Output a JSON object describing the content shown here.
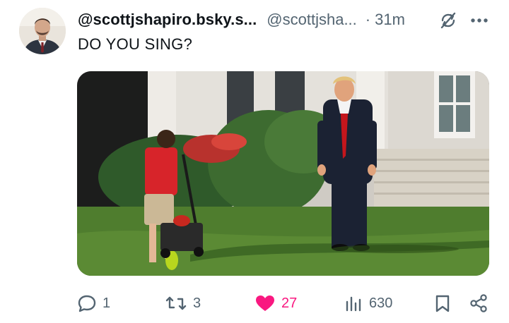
{
  "post": {
    "display_name": "@scottjshapiro.bsky.s...",
    "handle": "@scottjsha...",
    "separator": "·",
    "time": "31m",
    "text": "DO YOU SING?",
    "header_icons": [
      "no-sync-icon",
      "more-icon"
    ]
  },
  "actions": {
    "reply": {
      "icon": "reply-icon",
      "count": "1"
    },
    "repost": {
      "icon": "repost-icon",
      "count": "3"
    },
    "like": {
      "icon": "heart-icon",
      "count": "27",
      "active": true
    },
    "views": {
      "icon": "views-icon",
      "count": "630"
    },
    "bookmark": {
      "icon": "bookmark-icon"
    },
    "share": {
      "icon": "share-icon"
    }
  },
  "colors": {
    "text": "#0f1419",
    "secondary": "#536471",
    "like": "#f91880"
  }
}
